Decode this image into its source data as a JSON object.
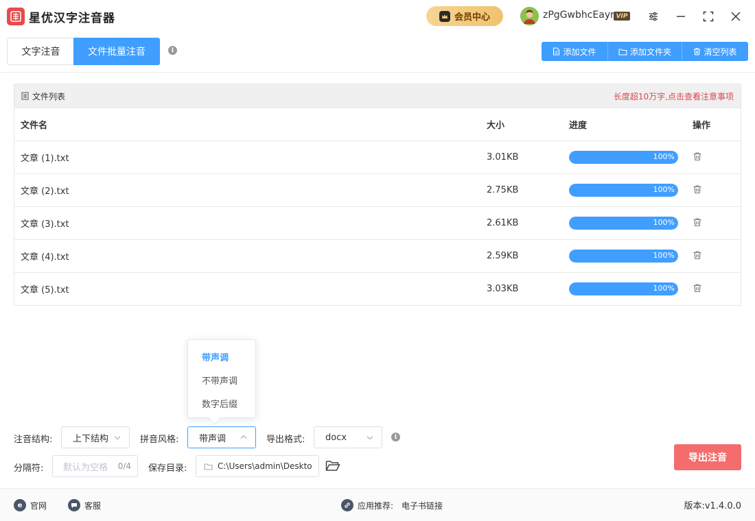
{
  "app": {
    "title": "星优汉字注音器"
  },
  "header": {
    "vip_center": "会员中心",
    "username": "zPgGwbhcEayr",
    "vip_badge": "VIP"
  },
  "tabs": [
    {
      "label": "文字注音",
      "active": false
    },
    {
      "label": "文件批量注音",
      "active": true
    }
  ],
  "toolbar": {
    "add_file": "添加文件",
    "add_folder": "添加文件夹",
    "clear_list": "清空列表"
  },
  "file_panel": {
    "title": "文件列表",
    "notice": "长度超10万字,点击查看注意事项",
    "columns": {
      "name": "文件名",
      "size": "大小",
      "progress": "进度",
      "actions": "操作"
    },
    "rows": [
      {
        "name": "文章 (1).txt",
        "size": "3.01KB",
        "progress_label": "100%",
        "progress": 1.0
      },
      {
        "name": "文章 (2).txt",
        "size": "2.75KB",
        "progress_label": "100%",
        "progress": 1.0
      },
      {
        "name": "文章 (3).txt",
        "size": "2.61KB",
        "progress_label": "100%",
        "progress": 1.0
      },
      {
        "name": "文章 (4).txt",
        "size": "2.59KB",
        "progress_label": "100%",
        "progress": 1.0
      },
      {
        "name": "文章 (5).txt",
        "size": "3.03KB",
        "progress_label": "100%",
        "progress": 1.0
      }
    ]
  },
  "pinyin_style_dropdown": {
    "options": [
      "带声调",
      "不带声调",
      "数字后缀"
    ],
    "selected": "带声调"
  },
  "settings": {
    "structure_label": "注音结构:",
    "structure_value": "上下结构",
    "pinyin_style_label": "拼音风格:",
    "pinyin_style_value": "带声调",
    "export_format_label": "导出格式:",
    "export_format_value": "docx",
    "separator_label": "分隔符:",
    "separator_placeholder": "默认为空格",
    "separator_count": "0/4",
    "save_dir_label": "保存目录:",
    "save_dir_value": "C:\\Users\\admin\\Deskto"
  },
  "export_button": "导出注音",
  "footer": {
    "website": "官网",
    "support": "客服",
    "recommend_label": "应用推荐:",
    "recommend_link": "电子书链接",
    "version": "版本:v1.4.0.0"
  },
  "colors": {
    "primary": "#409eff",
    "danger": "#f56c6c",
    "notice": "#e0454f",
    "vip_gold": "#f0c26c"
  },
  "icons": [
    "app-logo-icon",
    "crown-icon",
    "settings-sliders-icon",
    "minimize-icon",
    "maximize-icon",
    "close-icon",
    "info-icon",
    "file-icon",
    "folder-icon",
    "trash-icon",
    "list-icon",
    "folder-open-icon",
    "ie-icon",
    "chat-icon",
    "link-icon",
    "chevron-down-icon",
    "chevron-up-icon"
  ]
}
